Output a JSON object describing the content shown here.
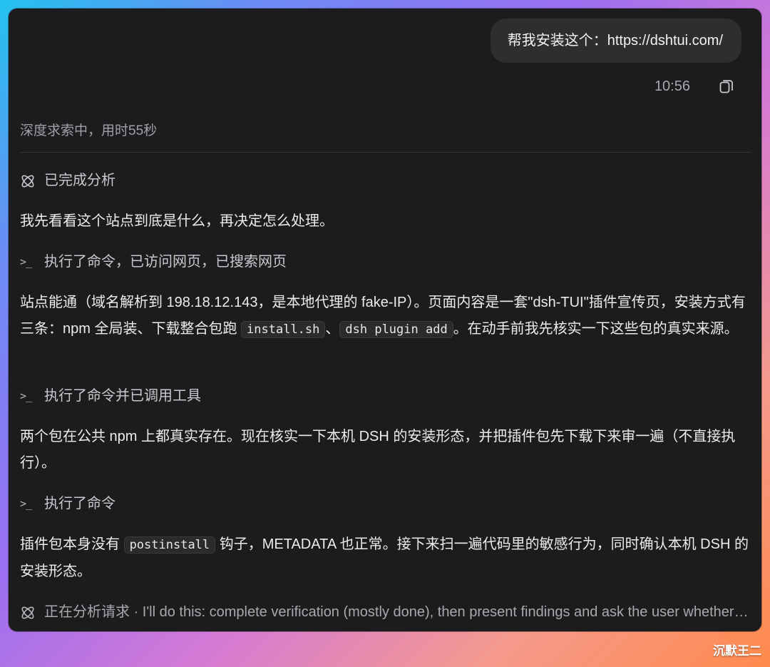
{
  "user_message": "帮我安装这个：https://dshtui.com/",
  "message_time": "10:56",
  "thinking_status": "深度求索中，用时55秒",
  "analysis_done_label": "已完成分析",
  "intro_text": "我先看看这个站点到底是什么，再决定怎么处理。",
  "step1_label": "执行了命令，已访问网页，已搜索网页",
  "para2": {
    "part1": "站点能通（域名解析到 198.18.12.143，是本地代理的 fake-IP）。页面内容是一套\"dsh-TUI\"插件宣传页，安装方式有三条：npm 全局装、下载整合包跑 ",
    "code1": "install.sh",
    "sep": "、",
    "code2": "dsh plugin add",
    "part2": "。在动手前我先核实一下这些包的真实来源。"
  },
  "step2_label": "执行了命令并已调用工具",
  "para3": "两个包在公共 npm 上都真实存在。现在核实一下本机 DSH 的安装形态，并把插件包先下载下来审一遍（不直接执行）。",
  "step3_label": "执行了命令",
  "para4": {
    "part1": "插件包本身没有 ",
    "code": "postinstall",
    "part2": " 钩子，METADATA 也正常。接下来扫一遍代码里的敏感行为，同时确认本机 DSH 的安装形态。"
  },
  "analyzing_label": "正在分析请求 · I'll do this: complete verification (mostly done), then present findings and ask the user whether to proceed with install...",
  "watermark": "沉默王二",
  "icons": {
    "copy": "copy-icon",
    "analysis": "atom-icon",
    "terminal": "terminal-prompt-icon"
  },
  "colors": {
    "window_bg": "#1c1c1e",
    "bubble_bg": "#2e2e31",
    "text": "#ececec",
    "muted": "#a0a0a6"
  }
}
